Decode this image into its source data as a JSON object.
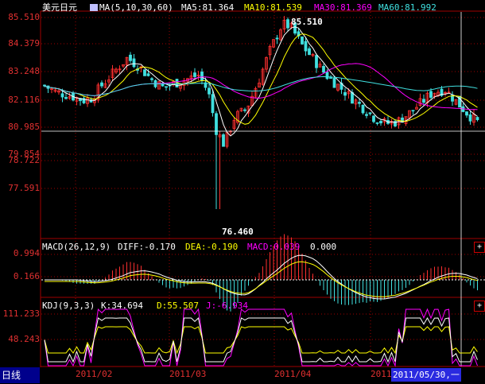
{
  "header": {
    "symbol": "美元日元",
    "ma_label": "MA(5,10,30,60)",
    "ma5": "MA5:81.364",
    "ma10": "MA10:81.539",
    "ma30": "MA30:81.369",
    "ma60": "MA60:81.992"
  },
  "price_panel": {
    "y_ticks": [
      "85.510",
      "84.379",
      "83.248",
      "82.116",
      "80.985",
      "79.854",
      "78.722",
      "77.591"
    ],
    "high_label": "85.510",
    "low_label": "76.460"
  },
  "macd_panel": {
    "title": "MACD(26,12,9)",
    "diff": "DIFF:-0.170",
    "dea": "DEA:-0.190",
    "macd": "MACD:0.039",
    "extra": "0.000",
    "y_ticks": [
      "0.994",
      "0.166"
    ]
  },
  "kdj_panel": {
    "title": "KDJ(9,3,3)",
    "k": "K:34.694",
    "d": "D:55.507",
    "j": "J:-6.934",
    "y_ticks": [
      "111.233",
      "48.243"
    ]
  },
  "x_axis": {
    "ticks": [
      "2011/02",
      "2011/03",
      "2011/04",
      "2011/05"
    ]
  },
  "footer": {
    "period_tab": "日线",
    "cursor_date": "2011/05/30,一"
  },
  "colors": {
    "up": "#ff3030",
    "down": "#40e0e0",
    "ma5": "#ffffff",
    "ma10": "#ffff00",
    "ma30": "#ff00ff",
    "ma60": "#40e0e0",
    "grid": "#a00000"
  },
  "chart_data": {
    "type": "candlestick",
    "ylim": [
      76.2,
      85.8
    ],
    "high": 85.51,
    "low": 76.46
  }
}
